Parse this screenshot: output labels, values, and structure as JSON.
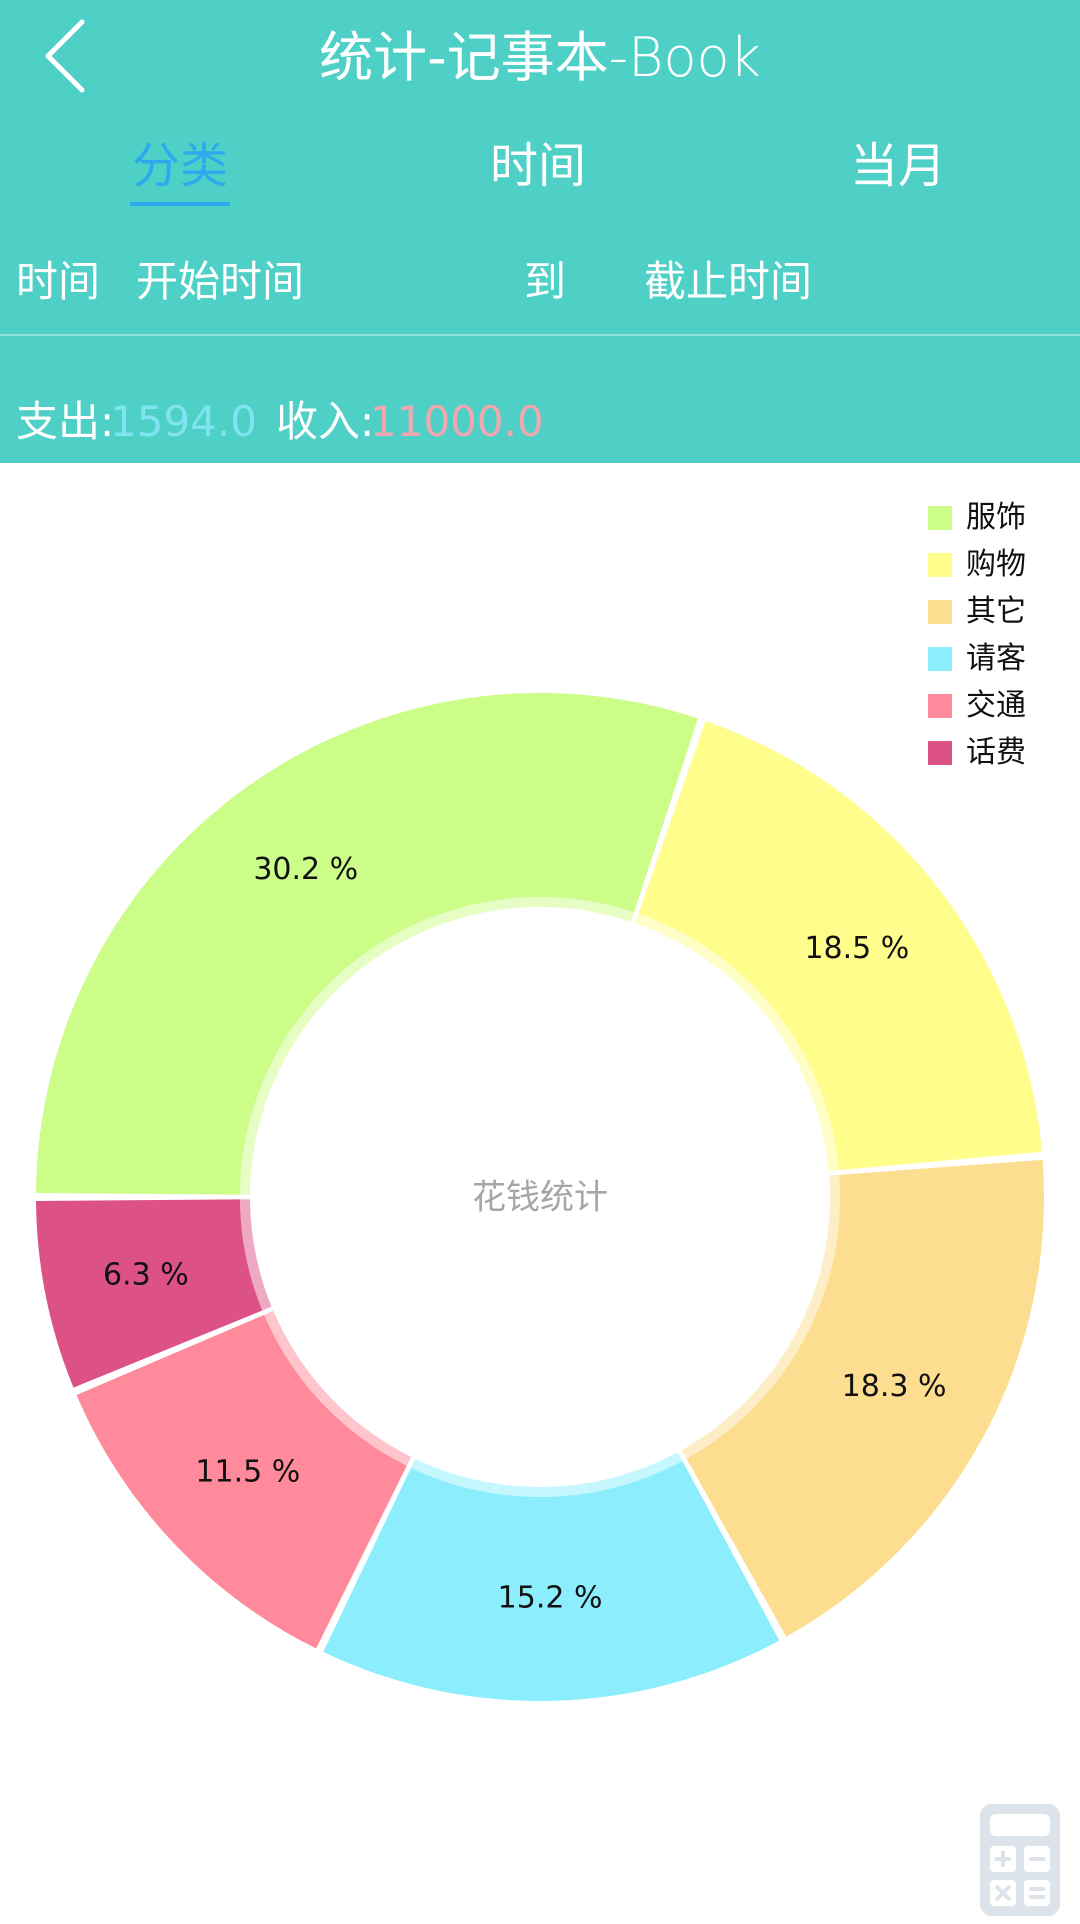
{
  "header": {
    "title_main": "统计-记事本",
    "title_suffix": "-Book",
    "back_icon": "chevron-left-icon",
    "bg_color": "#4fd0c6"
  },
  "tabs": [
    {
      "label": "分类",
      "active": true
    },
    {
      "label": "时间",
      "active": false
    },
    {
      "label": "当月",
      "active": false
    }
  ],
  "time_range": {
    "label": "时间",
    "start": "开始时间",
    "separator": "到",
    "end": "截止时间"
  },
  "totals": {
    "expense_label": "支出:",
    "expense_value": "1594.0",
    "income_label": "收入:",
    "income_value": "11000.0",
    "expense_color": "#7fe3f0",
    "income_color": "#f2a7ae"
  },
  "chart_data": {
    "type": "pie",
    "donut": true,
    "center_text": "花钱统计",
    "legend_position": "top-right",
    "slices": [
      {
        "label": "服饰",
        "value": 30.2,
        "display": "30.2 %",
        "color": "#ccfd88"
      },
      {
        "label": "购物",
        "value": 18.5,
        "display": "18.5 %",
        "color": "#fffd8c"
      },
      {
        "label": "其它",
        "value": 18.3,
        "display": "18.3 %",
        "color": "#fddd8f"
      },
      {
        "label": "请客",
        "value": 15.2,
        "display": "15.2 %",
        "color": "#8ceefd"
      },
      {
        "label": "交通",
        "value": 11.5,
        "display": "11.5 %",
        "color": "#fe8a9b"
      },
      {
        "label": "话费",
        "value": 6.3,
        "display": "6.3 %",
        "color": "#dc5286"
      }
    ]
  },
  "fab": {
    "icon": "calculator-icon"
  }
}
